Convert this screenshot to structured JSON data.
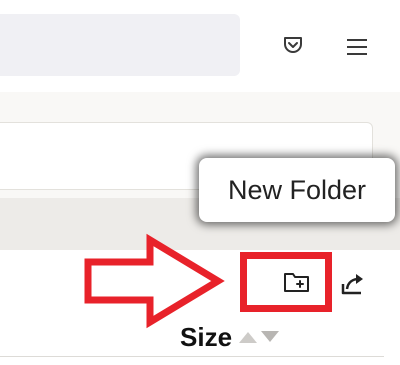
{
  "toolbar": {
    "pocket_icon": "pocket-icon",
    "menu_icon": "hamburger-menu-icon"
  },
  "tooltip": {
    "text": "New Folder"
  },
  "file_panel": {
    "new_folder_icon": "new-folder-icon",
    "share_icon": "share-icon",
    "columns": [
      {
        "label": "Size",
        "sort_icon": "sort-up-down-icon"
      }
    ]
  },
  "annotation": {
    "color": "#e8222a",
    "arrow_direction": "right"
  }
}
